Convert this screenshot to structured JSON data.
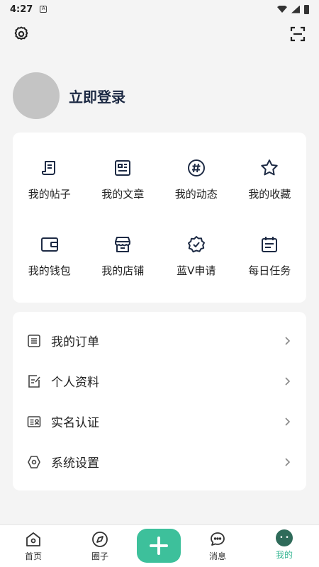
{
  "status_bar": {
    "time": "4:27"
  },
  "profile": {
    "login_label": "立即登录"
  },
  "grid": [
    {
      "label": "我的帖子",
      "icon": "post-icon"
    },
    {
      "label": "我的文章",
      "icon": "article-icon"
    },
    {
      "label": "我的动态",
      "icon": "hashtag-icon"
    },
    {
      "label": "我的收藏",
      "icon": "star-icon"
    },
    {
      "label": "我的钱包",
      "icon": "wallet-icon"
    },
    {
      "label": "我的店铺",
      "icon": "store-icon"
    },
    {
      "label": "蓝V申请",
      "icon": "badge-check-icon"
    },
    {
      "label": "每日任务",
      "icon": "calendar-icon"
    }
  ],
  "list": [
    {
      "label": "我的订单",
      "icon": "order-icon"
    },
    {
      "label": "个人资料",
      "icon": "edit-icon"
    },
    {
      "label": "实名认证",
      "icon": "id-card-icon"
    },
    {
      "label": "系统设置",
      "icon": "hexagon-gear-icon"
    }
  ],
  "tabs": {
    "home": "首页",
    "circle": "圈子",
    "messages": "消息",
    "me": "我的"
  },
  "colors": {
    "accent": "#3dc09b",
    "active_tab": "#3bb896"
  }
}
